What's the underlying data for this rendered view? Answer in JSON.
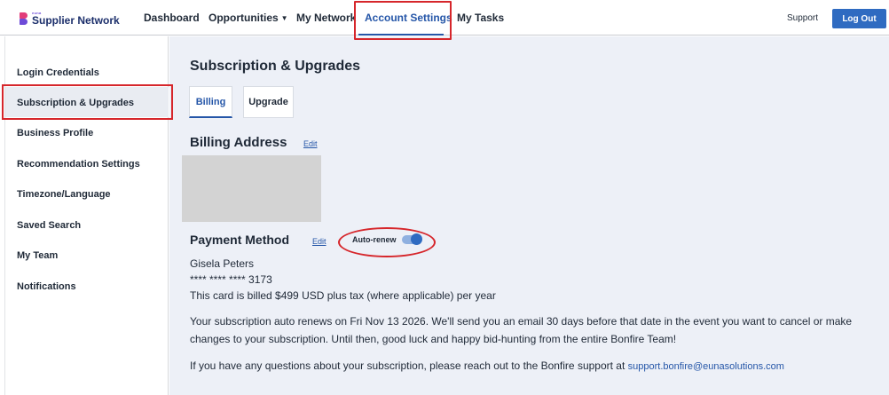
{
  "brand": {
    "superscript": "euna",
    "name": "Supplier Network"
  },
  "nav": {
    "items": [
      {
        "label": "Dashboard"
      },
      {
        "label": "Opportunities"
      },
      {
        "label": "My Network"
      },
      {
        "label": "Account Settings"
      },
      {
        "label": "My Tasks"
      }
    ],
    "support": "Support",
    "logout": "Log Out"
  },
  "sidebar": {
    "items": [
      {
        "label": "Login Credentials"
      },
      {
        "label": "Subscription & Upgrades"
      },
      {
        "label": "Business Profile"
      },
      {
        "label": "Recommendation Settings"
      },
      {
        "label": "Timezone/Language"
      },
      {
        "label": "Saved Search"
      },
      {
        "label": "My Team"
      },
      {
        "label": "Notifications"
      }
    ]
  },
  "main": {
    "title": "Subscription & Upgrades",
    "tabs": [
      {
        "label": "Billing"
      },
      {
        "label": "Upgrade"
      }
    ],
    "billing_address": {
      "title": "Billing Address",
      "edit": "Edit"
    },
    "payment_method": {
      "title": "Payment Method",
      "edit": "Edit",
      "autorenew_label": "Auto-renew",
      "autorenew_on": true,
      "card_holder": "Gisela Peters",
      "card_number": "**** **** **** 3173",
      "billing_note": "This card is billed $499 USD plus tax (where applicable) per year"
    },
    "renewal_line1": "Your subscription auto renews on Fri Nov 13 2026. We'll send you an email 30 days before that date in the event you want to cancel or make",
    "renewal_line2": "changes to your subscription. Until then, good luck and happy bid-hunting from the entire Bonfire Team!",
    "support_text": "If you have any questions about your subscription, please reach out to the Bonfire support at ",
    "support_email": "support.bonfire@eunasolutions.com"
  },
  "colors": {
    "accent": "#2556a8",
    "button": "#2f6bc1",
    "highlight": "#d6262b",
    "main_bg": "#edf0f7"
  }
}
